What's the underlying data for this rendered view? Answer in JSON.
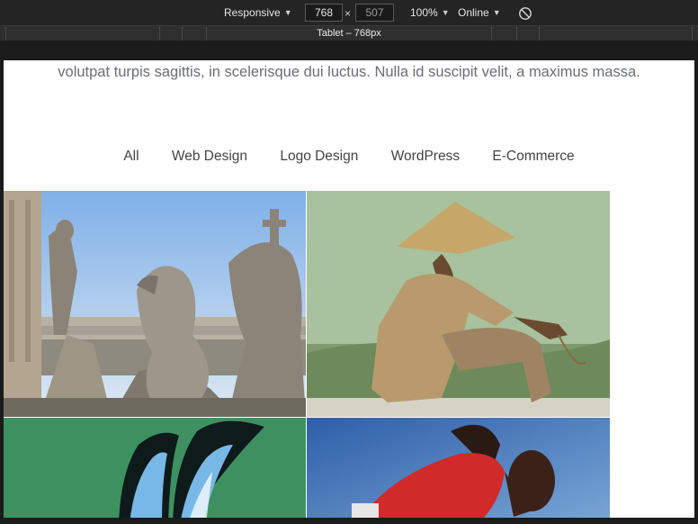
{
  "toolbar": {
    "device": "Responsive",
    "width": "768",
    "height_placeholder": "507",
    "times": "×",
    "zoom": "100%",
    "throttling": "Online"
  },
  "media_query": {
    "label": "Tablet – 768px"
  },
  "page": {
    "intro_text": "volutpat turpis sagittis, in scelerisque dui luctus. Nulla id suscipit velit, a maximus massa.",
    "filters": [
      "All",
      "Web Design",
      "Logo Design",
      "WordPress",
      "E-Commerce"
    ]
  },
  "colors": {
    "accent_green": "#3d9161",
    "sky_blue": "#4f86c6"
  }
}
